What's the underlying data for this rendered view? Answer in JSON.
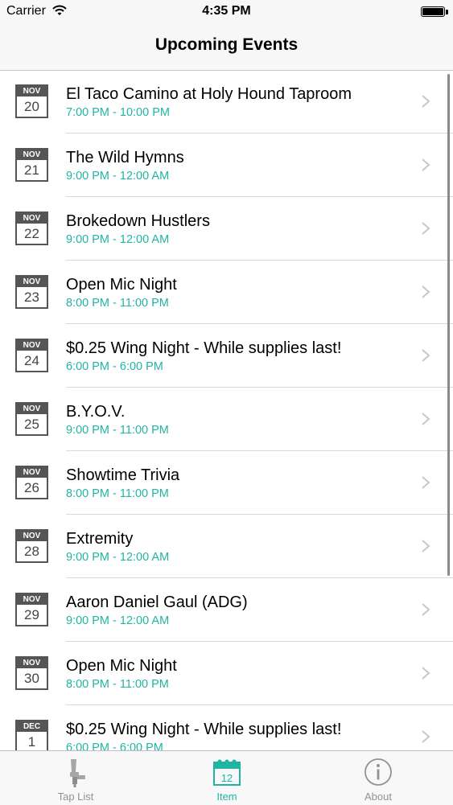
{
  "status_bar": {
    "carrier": "Carrier",
    "time": "4:35 PM"
  },
  "nav": {
    "title": "Upcoming Events"
  },
  "events": [
    {
      "month": "NOV",
      "day": "20",
      "title": "El Taco Camino at Holy Hound Taproom",
      "time": "7:00 PM - 10:00 PM"
    },
    {
      "month": "NOV",
      "day": "21",
      "title": "The Wild Hymns",
      "time": "9:00 PM - 12:00 AM"
    },
    {
      "month": "NOV",
      "day": "22",
      "title": "Brokedown Hustlers",
      "time": "9:00 PM - 12:00 AM"
    },
    {
      "month": "NOV",
      "day": "23",
      "title": "Open Mic Night",
      "time": "8:00 PM - 11:00 PM"
    },
    {
      "month": "NOV",
      "day": "24",
      "title": "$0.25 Wing Night - While supplies last!",
      "time": "6:00 PM - 6:00 PM"
    },
    {
      "month": "NOV",
      "day": "25",
      "title": "B.Y.O.V.",
      "time": "9:00 PM - 11:00 PM"
    },
    {
      "month": "NOV",
      "day": "26",
      "title": "Showtime Trivia",
      "time": "8:00 PM - 11:00 PM"
    },
    {
      "month": "NOV",
      "day": "28",
      "title": "Extremity",
      "time": "9:00 PM - 12:00 AM"
    },
    {
      "month": "NOV",
      "day": "29",
      "title": "Aaron Daniel Gaul (ADG)",
      "time": "9:00 PM - 12:00 AM"
    },
    {
      "month": "NOV",
      "day": "30",
      "title": "Open Mic Night",
      "time": "8:00 PM - 11:00 PM"
    },
    {
      "month": "DEC",
      "day": "1",
      "title": "$0.25 Wing Night - While supplies last!",
      "time": "6:00 PM - 6:00 PM"
    }
  ],
  "tabs": [
    {
      "label": "Tap List",
      "icon": "beer-tap-icon",
      "active": false
    },
    {
      "label": "Item",
      "icon": "calendar-icon",
      "active": true,
      "badge": "12"
    },
    {
      "label": "About",
      "icon": "info-icon",
      "active": false
    }
  ],
  "colors": {
    "accent": "#20b5a3",
    "inactive": "#929292",
    "bar_background": "#f7f7f8"
  }
}
